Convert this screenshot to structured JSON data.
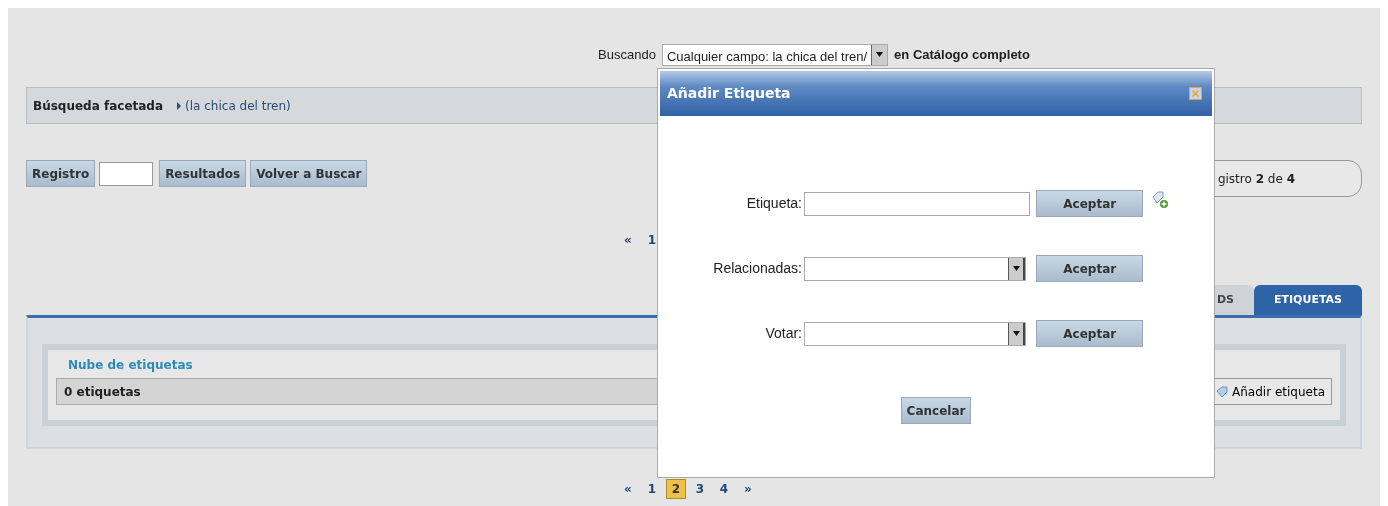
{
  "search": {
    "label": "Buscando",
    "query": "Cualquier campo: la chica del tren/",
    "scope": "en Catálogo completo"
  },
  "facets": {
    "title": "Búsqueda facetada",
    "items": [
      "(la chica del tren)"
    ]
  },
  "record_nav": {
    "record_button": "Registro",
    "buttons": [
      "Resultados",
      "Volver a Buscar"
    ],
    "counter": "gistro **2** de **4**"
  },
  "pagination_top": [
    {
      "label": "«",
      "selected": false
    },
    {
      "label": "1",
      "selected": false
    }
  ],
  "tabs": [
    {
      "label": "DS",
      "selected": false
    },
    {
      "label": "ETIQUETAS",
      "selected": true
    }
  ],
  "tag_cloud": {
    "title": "Nube de etiquetas",
    "count": "0 etiquetas",
    "add_button": "Añadir etiqueta"
  },
  "pagination_bottom": [
    {
      "label": "«",
      "selected": false
    },
    {
      "label": "1",
      "selected": false
    },
    {
      "label": "2",
      "selected": true
    },
    {
      "label": "3",
      "selected": false
    },
    {
      "label": "4",
      "selected": false
    },
    {
      "label": "»",
      "selected": false
    }
  ],
  "dialog": {
    "title": "Añadir Etiqueta",
    "rows": [
      {
        "label": "Etiqueta:",
        "kind": "text",
        "button": "Aceptar"
      },
      {
        "label": "Relacionadas:",
        "kind": "select",
        "button": "Aceptar"
      },
      {
        "label": "Votar:",
        "kind": "select",
        "button": "Aceptar"
      }
    ],
    "cancel": "Cancelar"
  }
}
